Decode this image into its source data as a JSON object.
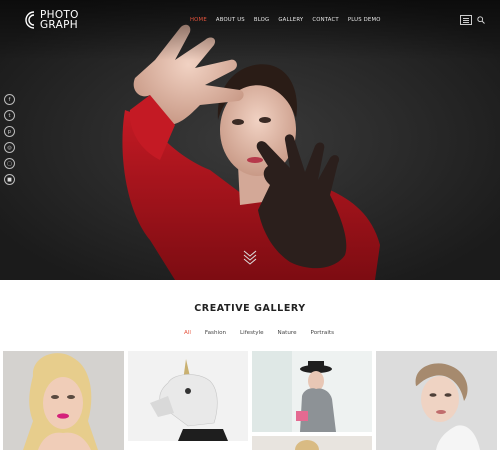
{
  "logo": {
    "line1": "PHOTO",
    "line2": "GRAPH"
  },
  "nav": [
    {
      "label": "HOME",
      "active": true
    },
    {
      "label": "ABOUT US",
      "active": false
    },
    {
      "label": "BLOG",
      "active": false
    },
    {
      "label": "GALLERY",
      "active": false
    },
    {
      "label": "CONTACT",
      "active": false
    },
    {
      "label": "PLUS DEMO",
      "active": false
    }
  ],
  "social_icons": [
    "facebook-icon",
    "twitter-icon",
    "pinterest-icon",
    "dribbble-icon",
    "instagram-icon",
    "behance-icon"
  ],
  "gallery": {
    "title": "CREATIVE GALLERY",
    "filters": [
      {
        "label": "All",
        "active": true
      },
      {
        "label": "Fashion",
        "active": false
      },
      {
        "label": "Lifestyle",
        "active": false
      },
      {
        "label": "Nature",
        "active": false
      },
      {
        "label": "Portraits",
        "active": false
      }
    ]
  },
  "colors": {
    "accent": "#e5533c",
    "hero_bg": "#2d2d2d",
    "dress": "#b3121c"
  }
}
